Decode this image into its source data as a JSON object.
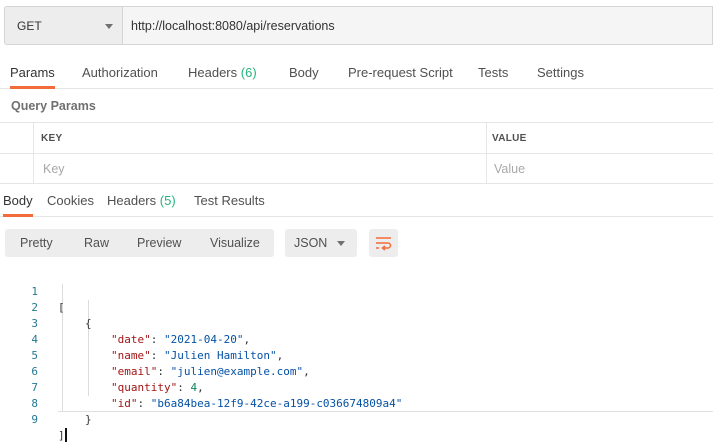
{
  "request": {
    "method": "GET",
    "url": "http://localhost:8080/api/reservations"
  },
  "request_tabs": [
    {
      "label": "Params",
      "count": ""
    },
    {
      "label": "Authorization",
      "count": ""
    },
    {
      "label": "Headers",
      "count": "(6)"
    },
    {
      "label": "Body",
      "count": ""
    },
    {
      "label": "Pre-request Script",
      "count": ""
    },
    {
      "label": "Tests",
      "count": ""
    },
    {
      "label": "Settings",
      "count": ""
    }
  ],
  "params": {
    "title": "Query Params",
    "key_header": "KEY",
    "value_header": "VALUE",
    "key_placeholder": "Key",
    "value_placeholder": "Value"
  },
  "response_tabs": [
    {
      "label": "Body",
      "count": ""
    },
    {
      "label": "Cookies",
      "count": ""
    },
    {
      "label": "Headers",
      "count": "(5)"
    },
    {
      "label": "Test Results",
      "count": ""
    }
  ],
  "view_modes": [
    "Pretty",
    "Raw",
    "Preview",
    "Visualize"
  ],
  "format": "JSON",
  "colors": {
    "accent": "#f26b3a",
    "count": "#26b47f"
  },
  "response_body": {
    "line_numbers": [
      "1",
      "2",
      "3",
      "4",
      "5",
      "6",
      "7",
      "8",
      "9"
    ],
    "open_array": "[",
    "open_object": "{",
    "fields": [
      {
        "key": "\"date\"",
        "value": "\"2021-04-20\"",
        "type": "string",
        "comma": ","
      },
      {
        "key": "\"name\"",
        "value": "\"Julien Hamilton\"",
        "type": "string",
        "comma": ","
      },
      {
        "key": "\"email\"",
        "value": "\"julien@example.com\"",
        "type": "string",
        "comma": ","
      },
      {
        "key": "\"quantity\"",
        "value": "4",
        "type": "number",
        "comma": ","
      },
      {
        "key": "\"id\"",
        "value": "\"b6a84bea-12f9-42ce-a199-c036674809a4\"",
        "type": "string",
        "comma": ""
      }
    ],
    "close_object": "}",
    "close_array": "]"
  }
}
